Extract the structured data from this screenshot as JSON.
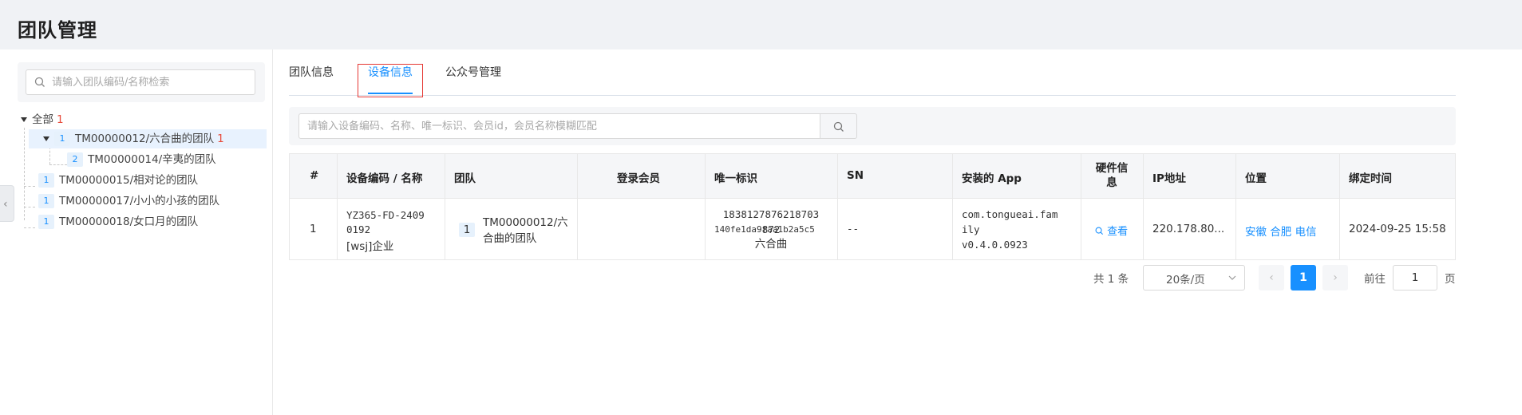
{
  "page": {
    "title": "团队管理"
  },
  "tree": {
    "search_placeholder": "请输入团队编码/名称检索",
    "root_label": "全部",
    "root_count": "1",
    "nodes": [
      {
        "level": "1",
        "label": "TM00000012/六合曲的团队",
        "count": "1"
      },
      {
        "level": "2",
        "label": "TM00000014/辛夷的团队"
      },
      {
        "level": "1",
        "label": "TM00000015/相对论的团队"
      },
      {
        "level": "1",
        "label": "TM00000017/小小的小孩的团队"
      },
      {
        "level": "1",
        "label": "TM00000018/女口月的团队"
      }
    ]
  },
  "tabs": [
    {
      "label": "团队信息"
    },
    {
      "label": "设备信息"
    },
    {
      "label": "公众号管理"
    }
  ],
  "device_search": {
    "placeholder": "请输入设备编码、名称、唯一标识、会员id，会员名称模糊匹配"
  },
  "table": {
    "headers": [
      "#",
      "设备编码 / 名称",
      "团队",
      "登录会员",
      "唯一标识",
      "SN",
      "安装的 App",
      "硬件信息",
      "IP地址",
      "位置",
      "绑定时间"
    ],
    "rows": [
      {
        "index": "1",
        "device_code_line1": "YZ365-FD-2409",
        "device_code_line2": "0192",
        "device_name": "[wsj]企业",
        "team_level": "1",
        "team_line1": "TM00000012/六",
        "team_line2": "合曲的团队",
        "member_id_line1": "1838127876218703",
        "member_id_line2": "872",
        "member_name": "六合曲",
        "unique_id": "140fe1da9faa1b2a5c5",
        "sn": "--",
        "app_line1": "com.tongueai.fam",
        "app_line2": "ily",
        "app_version": "v0.4.0.0923",
        "hardware_link": "查看",
        "ip": "220.178.80...",
        "location": "安徽 合肥 电信",
        "bind_time": "2024-09-25 15:58"
      }
    ]
  },
  "pagination": {
    "total_text": "共 1 条",
    "page_size": "20条/页",
    "current_page": "1",
    "goto_label": "前往",
    "goto_value": "1",
    "page_unit": "页"
  },
  "colors": {
    "accent": "#1890ff",
    "count_red": "#e74c3c",
    "outline_red": "#e53935"
  }
}
